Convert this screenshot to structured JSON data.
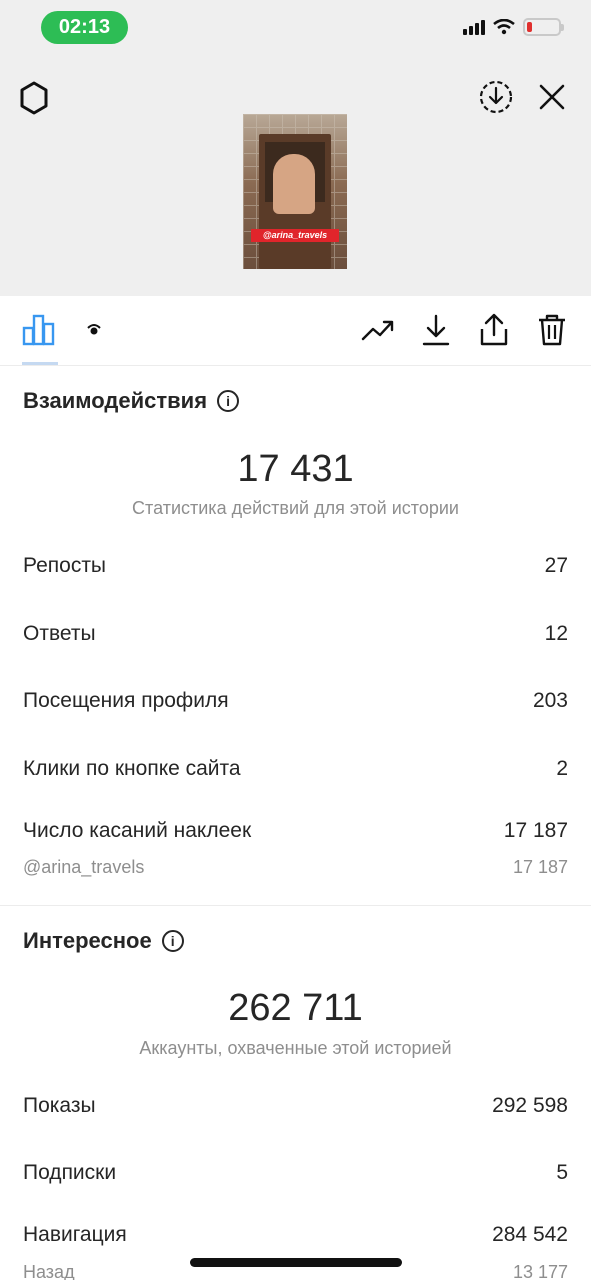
{
  "status_bar": {
    "time": "02:13"
  },
  "story_thumbnail": {
    "sticker_mention": "@arina_travels"
  },
  "tabs": {
    "insights_tab": "bar-chart-icon",
    "viewers_tab": "eye-icon"
  },
  "interactions": {
    "title": "Взаимодействия",
    "total": "17 431",
    "subtitle": "Статистика действий для этой истории",
    "rows": [
      {
        "label": "Репосты",
        "value": "27"
      },
      {
        "label": "Ответы",
        "value": "12"
      },
      {
        "label": "Посещения профиля",
        "value": "203"
      },
      {
        "label": "Клики по кнопке сайта",
        "value": "2"
      },
      {
        "label": "Число касаний наклеек",
        "value": "17 187"
      }
    ],
    "sticker_detail": {
      "label": "@arina_travels",
      "value": "17 187"
    }
  },
  "discovery": {
    "title": "Интересное",
    "total": "262 711",
    "subtitle": "Аккаунты, охваченные этой историей",
    "rows": [
      {
        "label": "Показы",
        "value": "292 598"
      },
      {
        "label": "Подписки",
        "value": "5"
      },
      {
        "label": "Навигация",
        "value": "284 542"
      }
    ],
    "nav_detail": {
      "label": "Назад",
      "value": "13 177"
    }
  }
}
